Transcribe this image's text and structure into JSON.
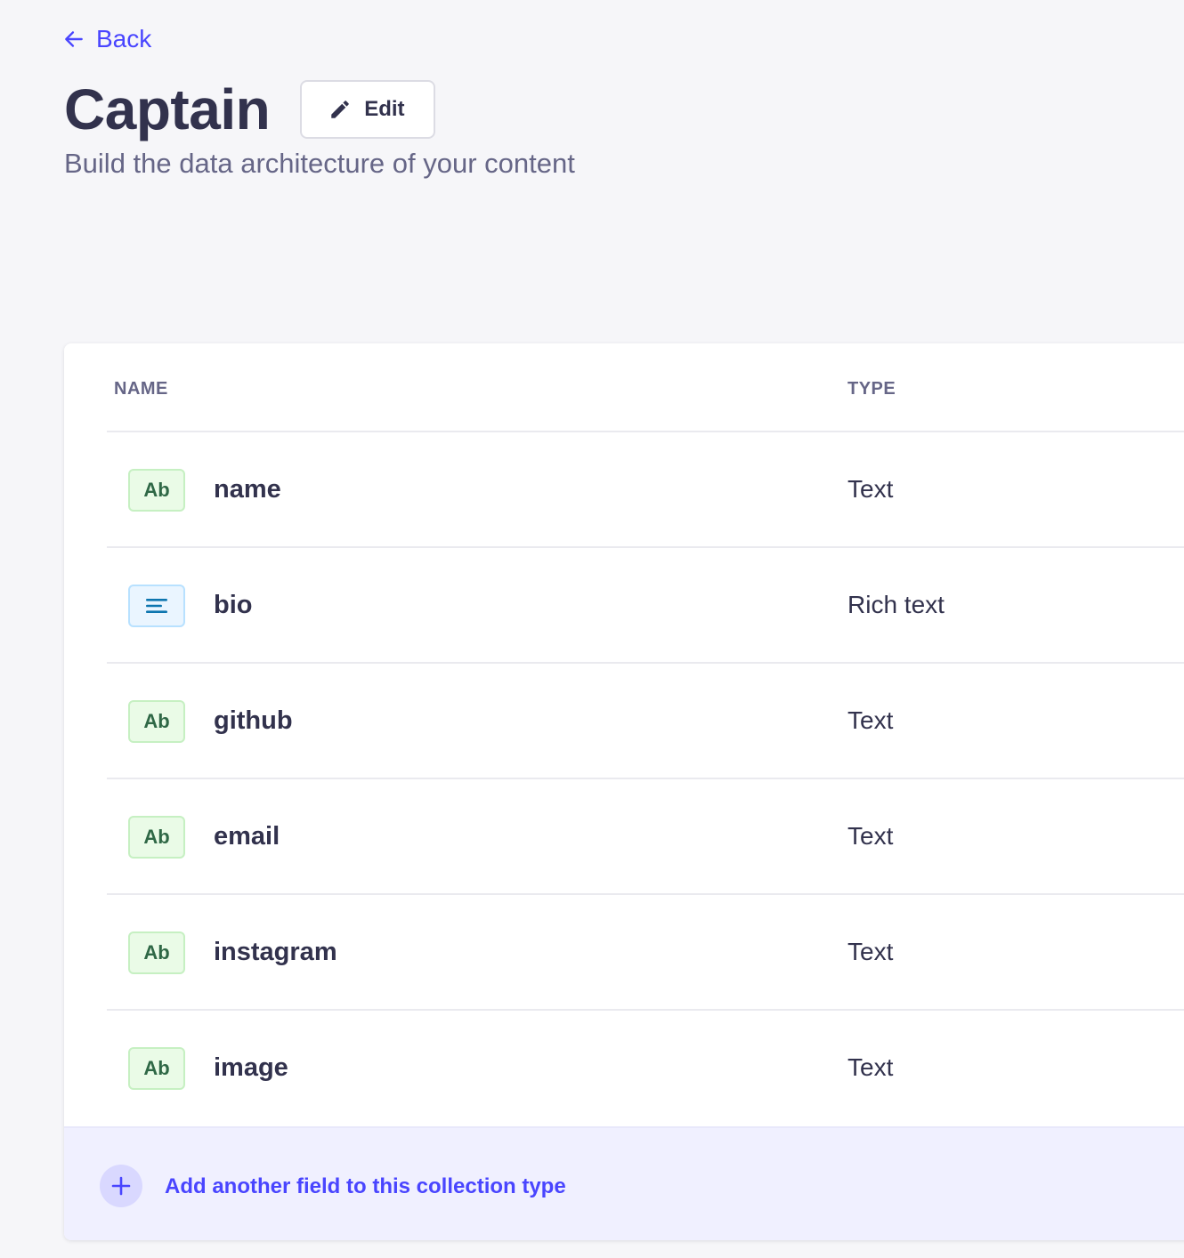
{
  "nav": {
    "back_label": "Back"
  },
  "header": {
    "title": "Captain",
    "edit_label": "Edit",
    "subtitle": "Build the data architecture of your content"
  },
  "table": {
    "columns": {
      "name": "NAME",
      "type": "TYPE"
    },
    "rows": [
      {
        "icon": "Ab",
        "icon_kind": "text-icon",
        "name": "name",
        "type": "Text"
      },
      {
        "icon": "",
        "icon_kind": "richtext-icon",
        "name": "bio",
        "type": "Rich text"
      },
      {
        "icon": "Ab",
        "icon_kind": "text-icon",
        "name": "github",
        "type": "Text"
      },
      {
        "icon": "Ab",
        "icon_kind": "text-icon",
        "name": "email",
        "type": "Text"
      },
      {
        "icon": "Ab",
        "icon_kind": "text-icon",
        "name": "instagram",
        "type": "Text"
      },
      {
        "icon": "Ab",
        "icon_kind": "text-icon",
        "name": "image",
        "type": "Text"
      }
    ]
  },
  "footer": {
    "add_label": "Add another field to this collection type"
  },
  "colors": {
    "accent": "#4945ff",
    "text_field_icon": "#2f6846",
    "richtext_field_icon": "#0c75af"
  }
}
